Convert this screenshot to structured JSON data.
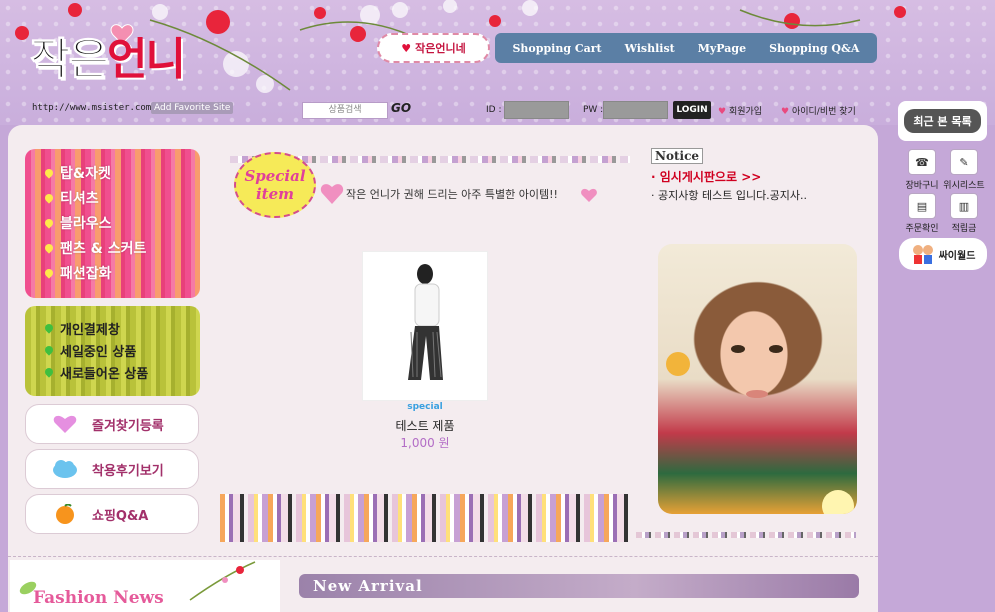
{
  "header": {
    "logo_part1": "작은",
    "logo_part2": "언니",
    "url": "http://www.msister.com",
    "add_favorite": "Add Favorite Site",
    "brand_button": "작은언니네",
    "nav": [
      "Shopping Cart",
      "Wishlist",
      "MyPage",
      "Shopping Q&A"
    ],
    "search_placeholder": "상품검색",
    "go_label": "GO",
    "id_label": "ID :",
    "pw_label": "PW :",
    "login_label": "LOGIN",
    "join_label": "회원가입",
    "find_label": "아이디/비번 찾기"
  },
  "categories": [
    "탑&자켓",
    "티셔츠",
    "블라우스",
    "팬츠 & 스커트",
    "패션잡화"
  ],
  "shop_menu": [
    "개인결제창",
    "세일중인 상품",
    "새로들어온 상품"
  ],
  "side_pills": [
    "즐겨찾기등록",
    "착용후기보기",
    "쇼핑Q&A"
  ],
  "special": {
    "line1": "Special",
    "line2": "item",
    "tagline": "작은 언니가 권해 드리는 아주 특별한 아이템!!"
  },
  "product": {
    "tag": "special",
    "name": "테스트 제품",
    "price": "1,000 원"
  },
  "notice": {
    "title": "Notice",
    "items": [
      "· 임시게시판으로 >>",
      "· 공지사항 테스트 입니다.공지사.."
    ]
  },
  "right_sidebar": {
    "recent_label": "최근 본 목록",
    "quick": [
      "장바구니",
      "위시리스트",
      "주문확인",
      "적립금"
    ],
    "cyworld": "싸이월드"
  },
  "bottom": {
    "fashion_news": "Fashion News",
    "new_arrival": "New Arrival"
  },
  "colors": {
    "background": "#c5a8d8",
    "nav": "#5b7fa5",
    "accent_pink": "#e0103a",
    "content_bg": "#f4ecef"
  }
}
